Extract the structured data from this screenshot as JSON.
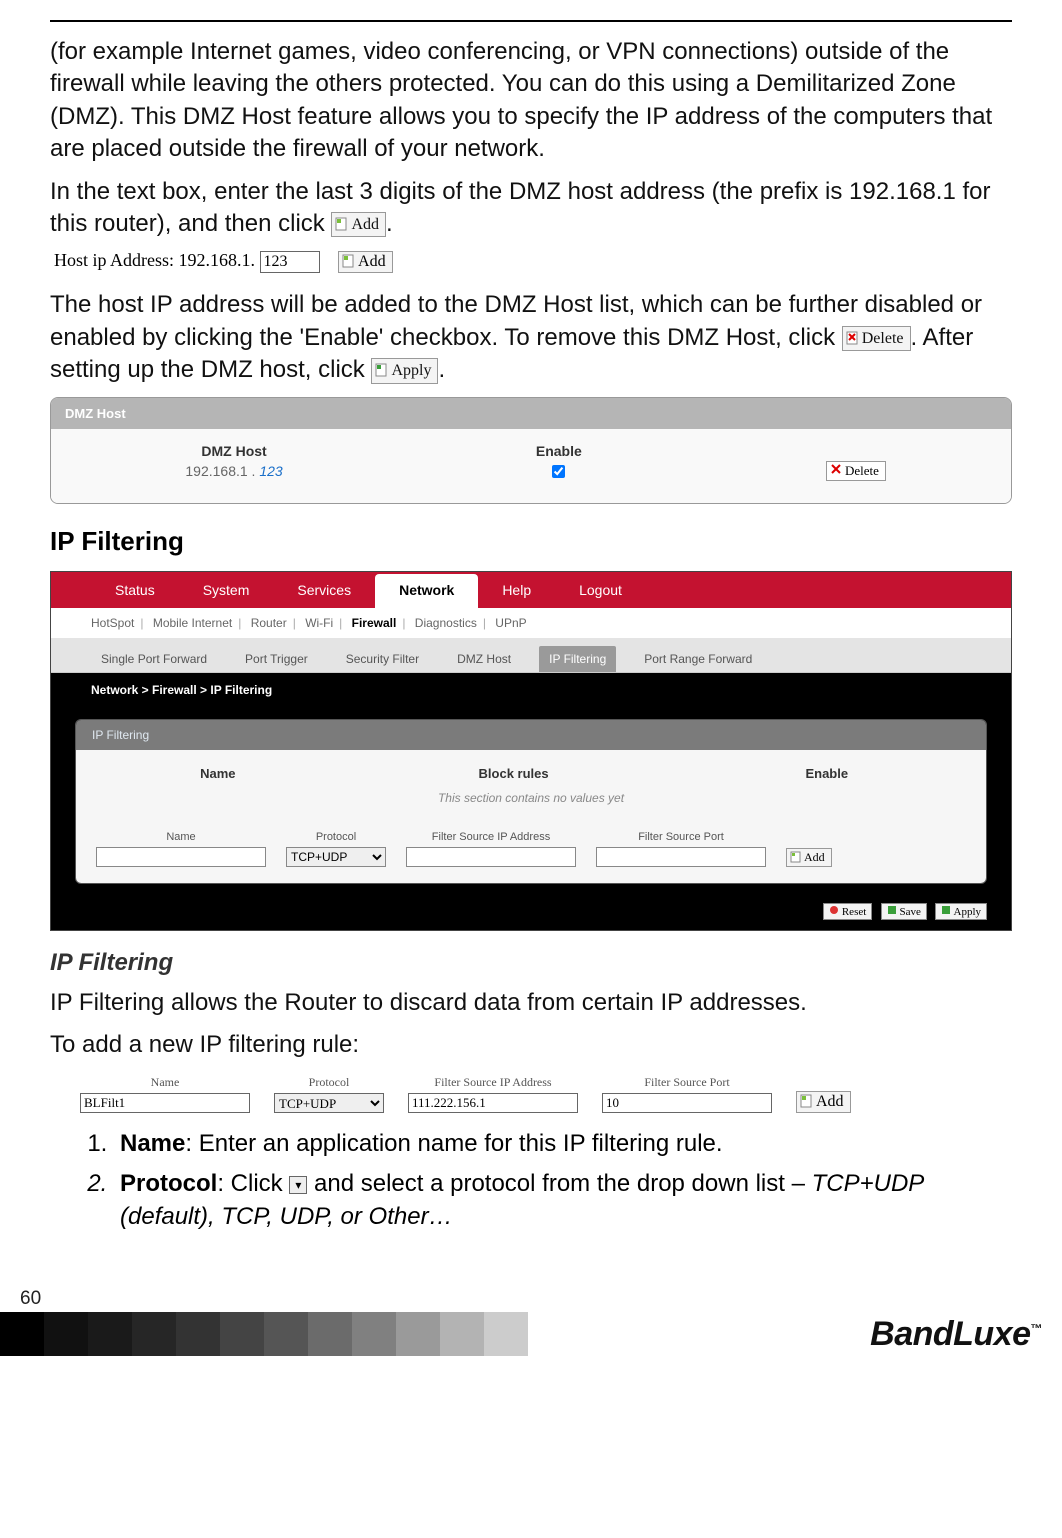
{
  "intro": {
    "p1": "(for example Internet games, video conferencing, or VPN connections) outside of the firewall while leaving the others protected. You can do this using a Demilitarized Zone (DMZ). This DMZ Host feature allows you to specify the IP address of the computers that are placed outside the firewall of your network.",
    "p2_a": "In the text box, enter the last 3 digits of the DMZ host address (the prefix is 192.168.1 for this router), and then click ",
    "p2_b": "."
  },
  "buttons": {
    "add": "Add",
    "delete": "Delete",
    "apply": "Apply",
    "reset": "Reset",
    "save": "Save"
  },
  "dmz_add": {
    "label": "Host ip Address: 192.168.1.",
    "value": "123"
  },
  "p3": {
    "a": "The host IP address will be added to the DMZ Host list, which can be further disabled or enabled by clicking the 'Enable' checkbox. To remove this DMZ Host, click ",
    "b": ". After setting up the DMZ host, click ",
    "c": "."
  },
  "dmz_panel": {
    "title": "DMZ Host",
    "col_host": "DMZ Host",
    "ip_prefix": "192.168.1 . ",
    "ip_suffix": "123",
    "col_enable": "Enable"
  },
  "heading_ipfiltering": "IP Filtering",
  "router": {
    "tabs": [
      "Status",
      "System",
      "Services",
      "Network",
      "Help",
      "Logout"
    ],
    "active_tab": "Network",
    "subnav": [
      "HotSpot",
      "Mobile Internet",
      "Router",
      "Wi-Fi",
      "Firewall",
      "Diagnostics",
      "UPnP"
    ],
    "subnav_active": "Firewall",
    "fw_tabs": [
      "Single Port Forward",
      "Port Trigger",
      "Security Filter",
      "DMZ Host",
      "IP Filtering",
      "Port Range Forward"
    ],
    "fw_active": "IP Filtering",
    "breadcrumb": "Network > Firewall > IP Filtering",
    "panel_title": "IP Filtering",
    "cols": {
      "name": "Name",
      "block": "Block rules",
      "enable": "Enable"
    },
    "empty": "This section contains no values yet",
    "form_labels": {
      "name": "Name",
      "protocol": "Protocol",
      "src": "Filter Source IP Address",
      "port": "Filter Source Port"
    },
    "protocol_value": "TCP+UDP"
  },
  "sub_h": "IP Filtering",
  "p4": "IP Filtering allows the Router to discard data from certain IP addresses.",
  "p5": "To add a new IP filtering rule:",
  "fig2": {
    "labels": {
      "name": "Name",
      "protocol": "Protocol",
      "src": "Filter Source IP Address",
      "port": "Filter Source Port"
    },
    "values": {
      "name": "BLFilt1",
      "protocol": "TCP+UDP",
      "src": "111.222.156.1",
      "port": "10"
    }
  },
  "steps": {
    "s1_label": "Name",
    "s1_text": ": Enter an application name for this IP filtering rule.",
    "s2_label": "Protocol",
    "s2_a": ": Click ",
    "s2_b": " and select a protocol from the drop down list – ",
    "s2_opts": "TCP+UDP (default), TCP, UDP, or Other…"
  },
  "page_number": "60",
  "brand": "BandLuxe",
  "tm": "™"
}
